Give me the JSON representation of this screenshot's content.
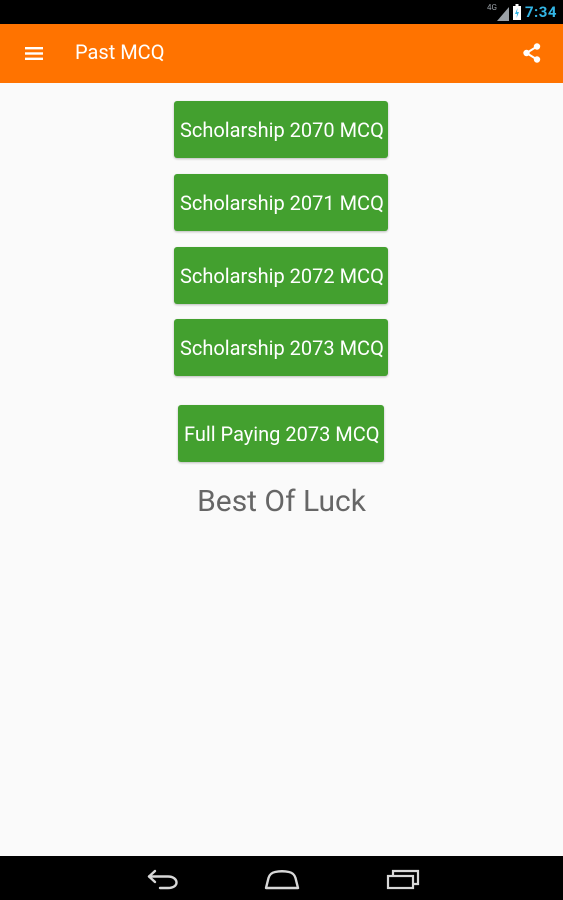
{
  "status_bar": {
    "network_type": "4G",
    "time": "7:34"
  },
  "app_bar": {
    "title": "Past MCQ",
    "menu_icon": "hamburger-menu-icon",
    "share_icon": "share-icon",
    "background_color": "#ff7300"
  },
  "main": {
    "buttons": [
      {
        "label": "Scholarship 2070 MCQ"
      },
      {
        "label": "Scholarship 2071 MCQ"
      },
      {
        "label": "Scholarship 2072 MCQ"
      },
      {
        "label": "Scholarship 2073 MCQ"
      },
      {
        "label": "Full Paying 2073 MCQ"
      }
    ],
    "button_color": "#43a02f",
    "message": "Best Of Luck"
  },
  "nav_bar": {
    "icons": [
      "back-icon",
      "home-icon",
      "recent-apps-icon"
    ]
  }
}
